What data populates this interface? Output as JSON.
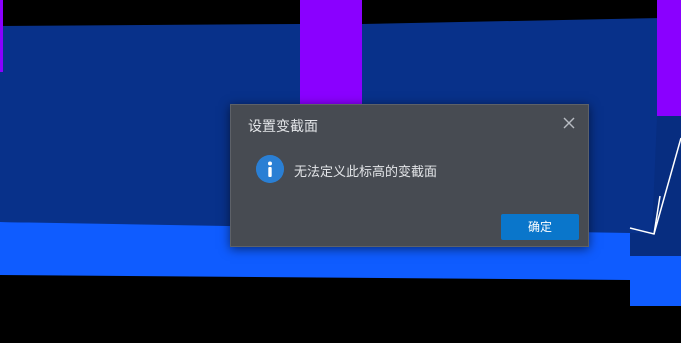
{
  "dialog": {
    "title": "设置变截面",
    "message": "无法定义此标高的变截面",
    "ok_label": "确定",
    "icon": "info-icon",
    "close_icon": "close-icon"
  },
  "colors": {
    "dark_blue": "#08318a",
    "bright_blue": "#0f5cff",
    "purple": "#8a00ff",
    "dialog_bg": "#474b52",
    "button_blue": "#0a76cb"
  }
}
